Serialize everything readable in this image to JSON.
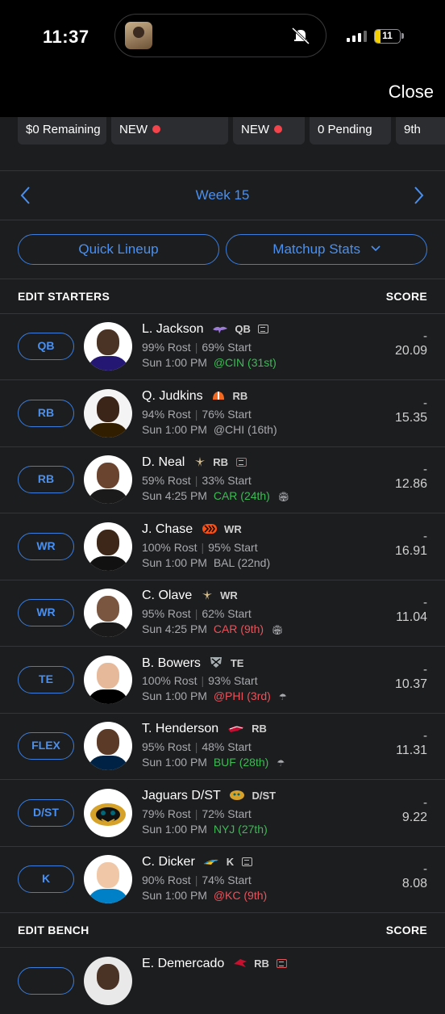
{
  "status": {
    "time": "11:37",
    "battery": "11"
  },
  "topbar": {
    "close": "Close"
  },
  "pills": [
    "$0 Remaining",
    "NEW",
    "NEW",
    "0 Pending",
    "9th"
  ],
  "week": {
    "label": "Week 15"
  },
  "buttons": {
    "quick_lineup": "Quick Lineup",
    "matchup_stats": "Matchup Stats"
  },
  "starters_header": {
    "title": "EDIT STARTERS",
    "score": "SCORE"
  },
  "bench_header": {
    "title": "EDIT BENCH",
    "score": "SCORE"
  },
  "players": [
    {
      "slot": "QB",
      "name": "L. Jackson",
      "pos": "QB",
      "rost": "99% Rost",
      "start": "69% Start",
      "time": "Sun 1:00 PM",
      "opp": "@CIN (31st)",
      "opp_color": "green",
      "dash": "-",
      "score": "20.09"
    },
    {
      "slot": "RB",
      "name": "Q. Judkins",
      "pos": "RB",
      "rost": "94% Rost",
      "start": "76% Start",
      "time": "Sun 1:00 PM",
      "opp": "@CHI (16th)",
      "opp_color": "gray",
      "dash": "-",
      "score": "15.35"
    },
    {
      "slot": "RB",
      "name": "D. Neal",
      "pos": "RB",
      "rost": "59% Rost",
      "start": "33% Start",
      "time": "Sun 4:25 PM",
      "opp": "CAR (24th)",
      "opp_color": "green",
      "dash": "-",
      "score": "12.86"
    },
    {
      "slot": "WR",
      "name": "J. Chase",
      "pos": "WR",
      "rost": "100% Rost",
      "start": "95% Start",
      "time": "Sun 1:00 PM",
      "opp": "BAL (22nd)",
      "opp_color": "gray",
      "dash": "-",
      "score": "16.91"
    },
    {
      "slot": "WR",
      "name": "C. Olave",
      "pos": "WR",
      "rost": "95% Rost",
      "start": "62% Start",
      "time": "Sun 4:25 PM",
      "opp": "CAR (9th)",
      "opp_color": "red",
      "dash": "-",
      "score": "11.04"
    },
    {
      "slot": "TE",
      "name": "B. Bowers",
      "pos": "TE",
      "rost": "100% Rost",
      "start": "93% Start",
      "time": "Sun 1:00 PM",
      "opp": "@PHI (3rd)",
      "opp_color": "red",
      "dash": "-",
      "score": "10.37"
    },
    {
      "slot": "FLEX",
      "name": "T. Henderson",
      "pos": "RB",
      "rost": "95% Rost",
      "start": "48% Start",
      "time": "Sun 1:00 PM",
      "opp": "BUF (28th)",
      "opp_color": "green",
      "dash": "-",
      "score": "11.31"
    },
    {
      "slot": "D/ST",
      "name": "Jaguars D/ST",
      "pos": "D/ST",
      "rost": "79% Rost",
      "start": "72% Start",
      "time": "Sun 1:00 PM",
      "opp": "NYJ (27th)",
      "opp_color": "green",
      "dash": "-",
      "score": "9.22"
    },
    {
      "slot": "K",
      "name": "C. Dicker",
      "pos": "K",
      "rost": "90% Rost",
      "start": "74% Start",
      "time": "Sun 1:00 PM",
      "opp": "@KC (9th)",
      "opp_color": "red",
      "dash": "-",
      "score": "8.08"
    }
  ],
  "bench_player": {
    "name": "E. Demercado",
    "pos": "RB"
  }
}
